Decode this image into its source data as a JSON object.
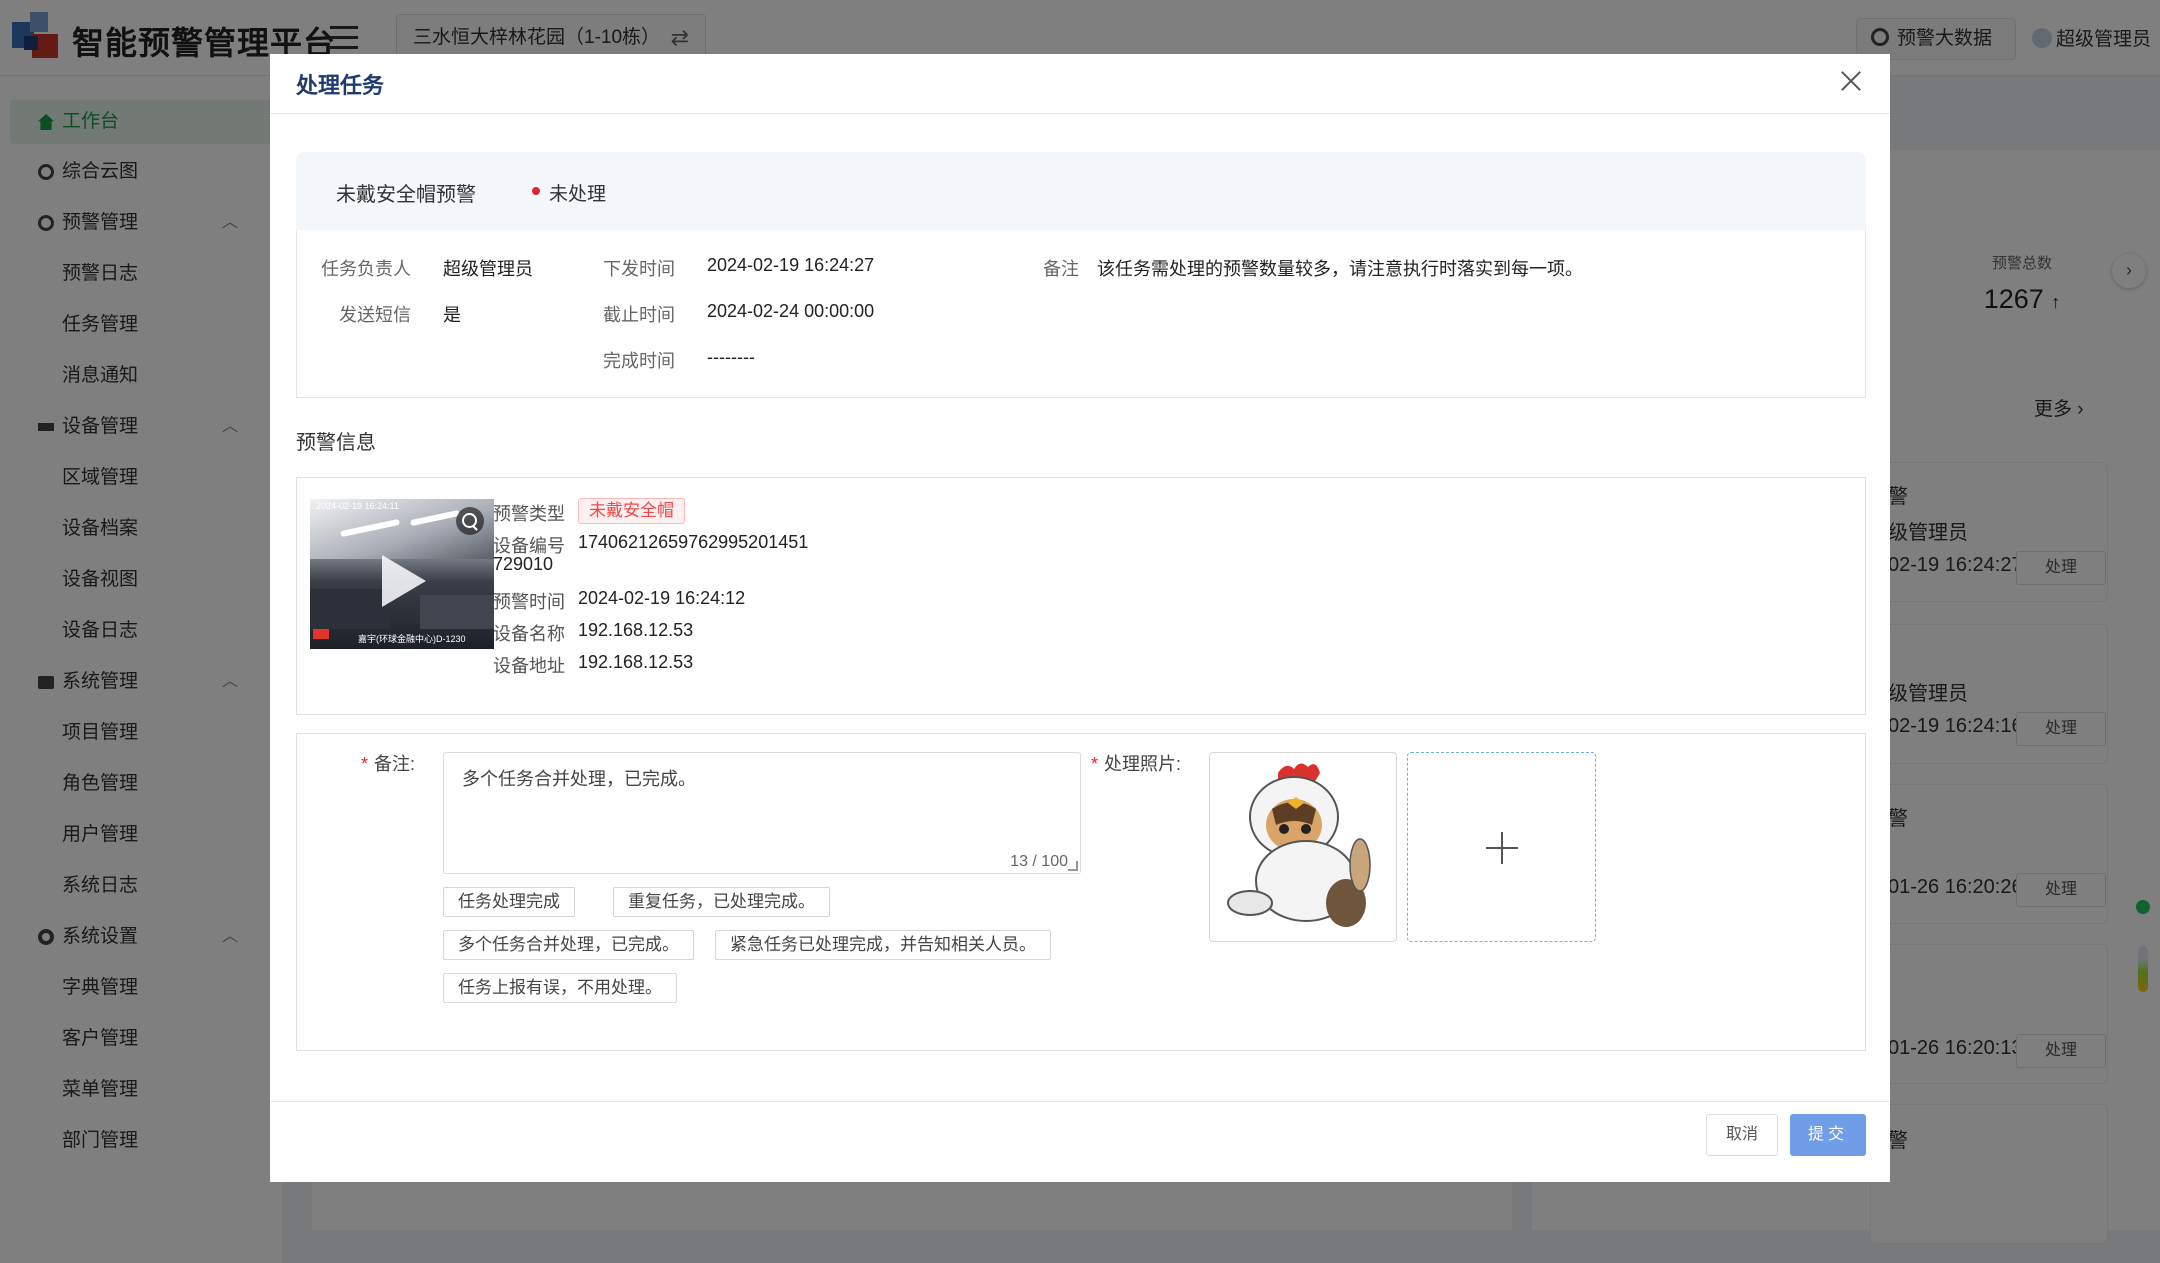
{
  "app": {
    "title": "智能预警管理平台",
    "project": "三水恒大梓林花园（1-10栋）",
    "big_data_button": "预警大数据",
    "user": "超级管理员"
  },
  "sidebar": {
    "items": [
      {
        "label": "工作台",
        "icon": "home-icon",
        "active": true
      },
      {
        "label": "综合云图",
        "icon": "cloud-icon"
      },
      {
        "label": "预警管理",
        "icon": "warning-icon",
        "expanded": true
      },
      {
        "label": "预警日志"
      },
      {
        "label": "任务管理"
      },
      {
        "label": "消息通知"
      },
      {
        "label": "设备管理",
        "icon": "camera-icon",
        "expanded": true
      },
      {
        "label": "区域管理"
      },
      {
        "label": "设备档案"
      },
      {
        "label": "设备视图"
      },
      {
        "label": "设备日志"
      },
      {
        "label": "系统管理",
        "icon": "briefcase-icon",
        "expanded": true
      },
      {
        "label": "项目管理"
      },
      {
        "label": "角色管理"
      },
      {
        "label": "用户管理"
      },
      {
        "label": "系统日志"
      },
      {
        "label": "系统设置",
        "icon": "settings-icon",
        "expanded": true
      },
      {
        "label": "字典管理"
      },
      {
        "label": "客户管理"
      },
      {
        "label": "菜单管理"
      },
      {
        "label": "部门管理"
      }
    ]
  },
  "right_panel": {
    "stat_label": "预警总数",
    "stat_value": "1267",
    "stat_trend": "↑",
    "more": "更多",
    "cards": [
      {
        "title": "警",
        "user": "级管理员",
        "time": "02-19 16:24:27",
        "action": "处理"
      },
      {
        "title": "",
        "user": "级管理员",
        "time": "02-19 16:24:16",
        "action": "处理"
      },
      {
        "title": "警",
        "user": "",
        "time": "01-26 16:20:26",
        "action": "处理"
      },
      {
        "title": "",
        "user": "",
        "time": "01-26 16:20:13",
        "action": "处理"
      },
      {
        "title": "警",
        "user": "",
        "time": "",
        "action": ""
      }
    ]
  },
  "modal": {
    "title": "处理任务",
    "task": {
      "name": "未戴安全帽预警",
      "status": "未处理",
      "status_color": "#e3262b",
      "owner_label": "任务负责人",
      "owner": "超级管理员",
      "sms_label": "发送短信",
      "sms": "是",
      "issued_label": "下发时间",
      "issued": "2024-02-19 16:24:27",
      "deadline_label": "截止时间",
      "deadline": "2024-02-24 00:00:00",
      "done_label": "完成时间",
      "done": "--------",
      "remark_label": "备注",
      "remark": "该任务需处理的预警数量较多，请注意执行时落实到每一项。"
    },
    "alert_section_title": "预警信息",
    "alert": {
      "thumb_timestamp": "2024-02-19 16:24:11",
      "thumb_caption": "嘉宇(环球金融中心)D-1230",
      "type_label": "预警类型",
      "type": "未戴安全帽",
      "device_no_label": "设备编号",
      "device_no_line1": "17406212659762995201451",
      "device_no_line2": "729010",
      "time_label": "预警时间",
      "time": "2024-02-19 16:24:12",
      "device_name_label": "设备名称",
      "device_name": "192.168.12.53",
      "device_addr_label": "设备地址",
      "device_addr": "192.168.12.53"
    },
    "form": {
      "remark_label": "备注:",
      "remark_value": "多个任务合并处理，已完成。",
      "counter": "13 / 100",
      "photo_label": "处理照片:",
      "quick_replies": [
        "任务处理完成",
        "重复任务，已处理完成。",
        "多个任务合并处理，已完成。",
        "紧急任务已处理完成，并告知相关人员。",
        "任务上报有误，不用处理。"
      ]
    },
    "cancel": "取消",
    "submit": "提交"
  }
}
